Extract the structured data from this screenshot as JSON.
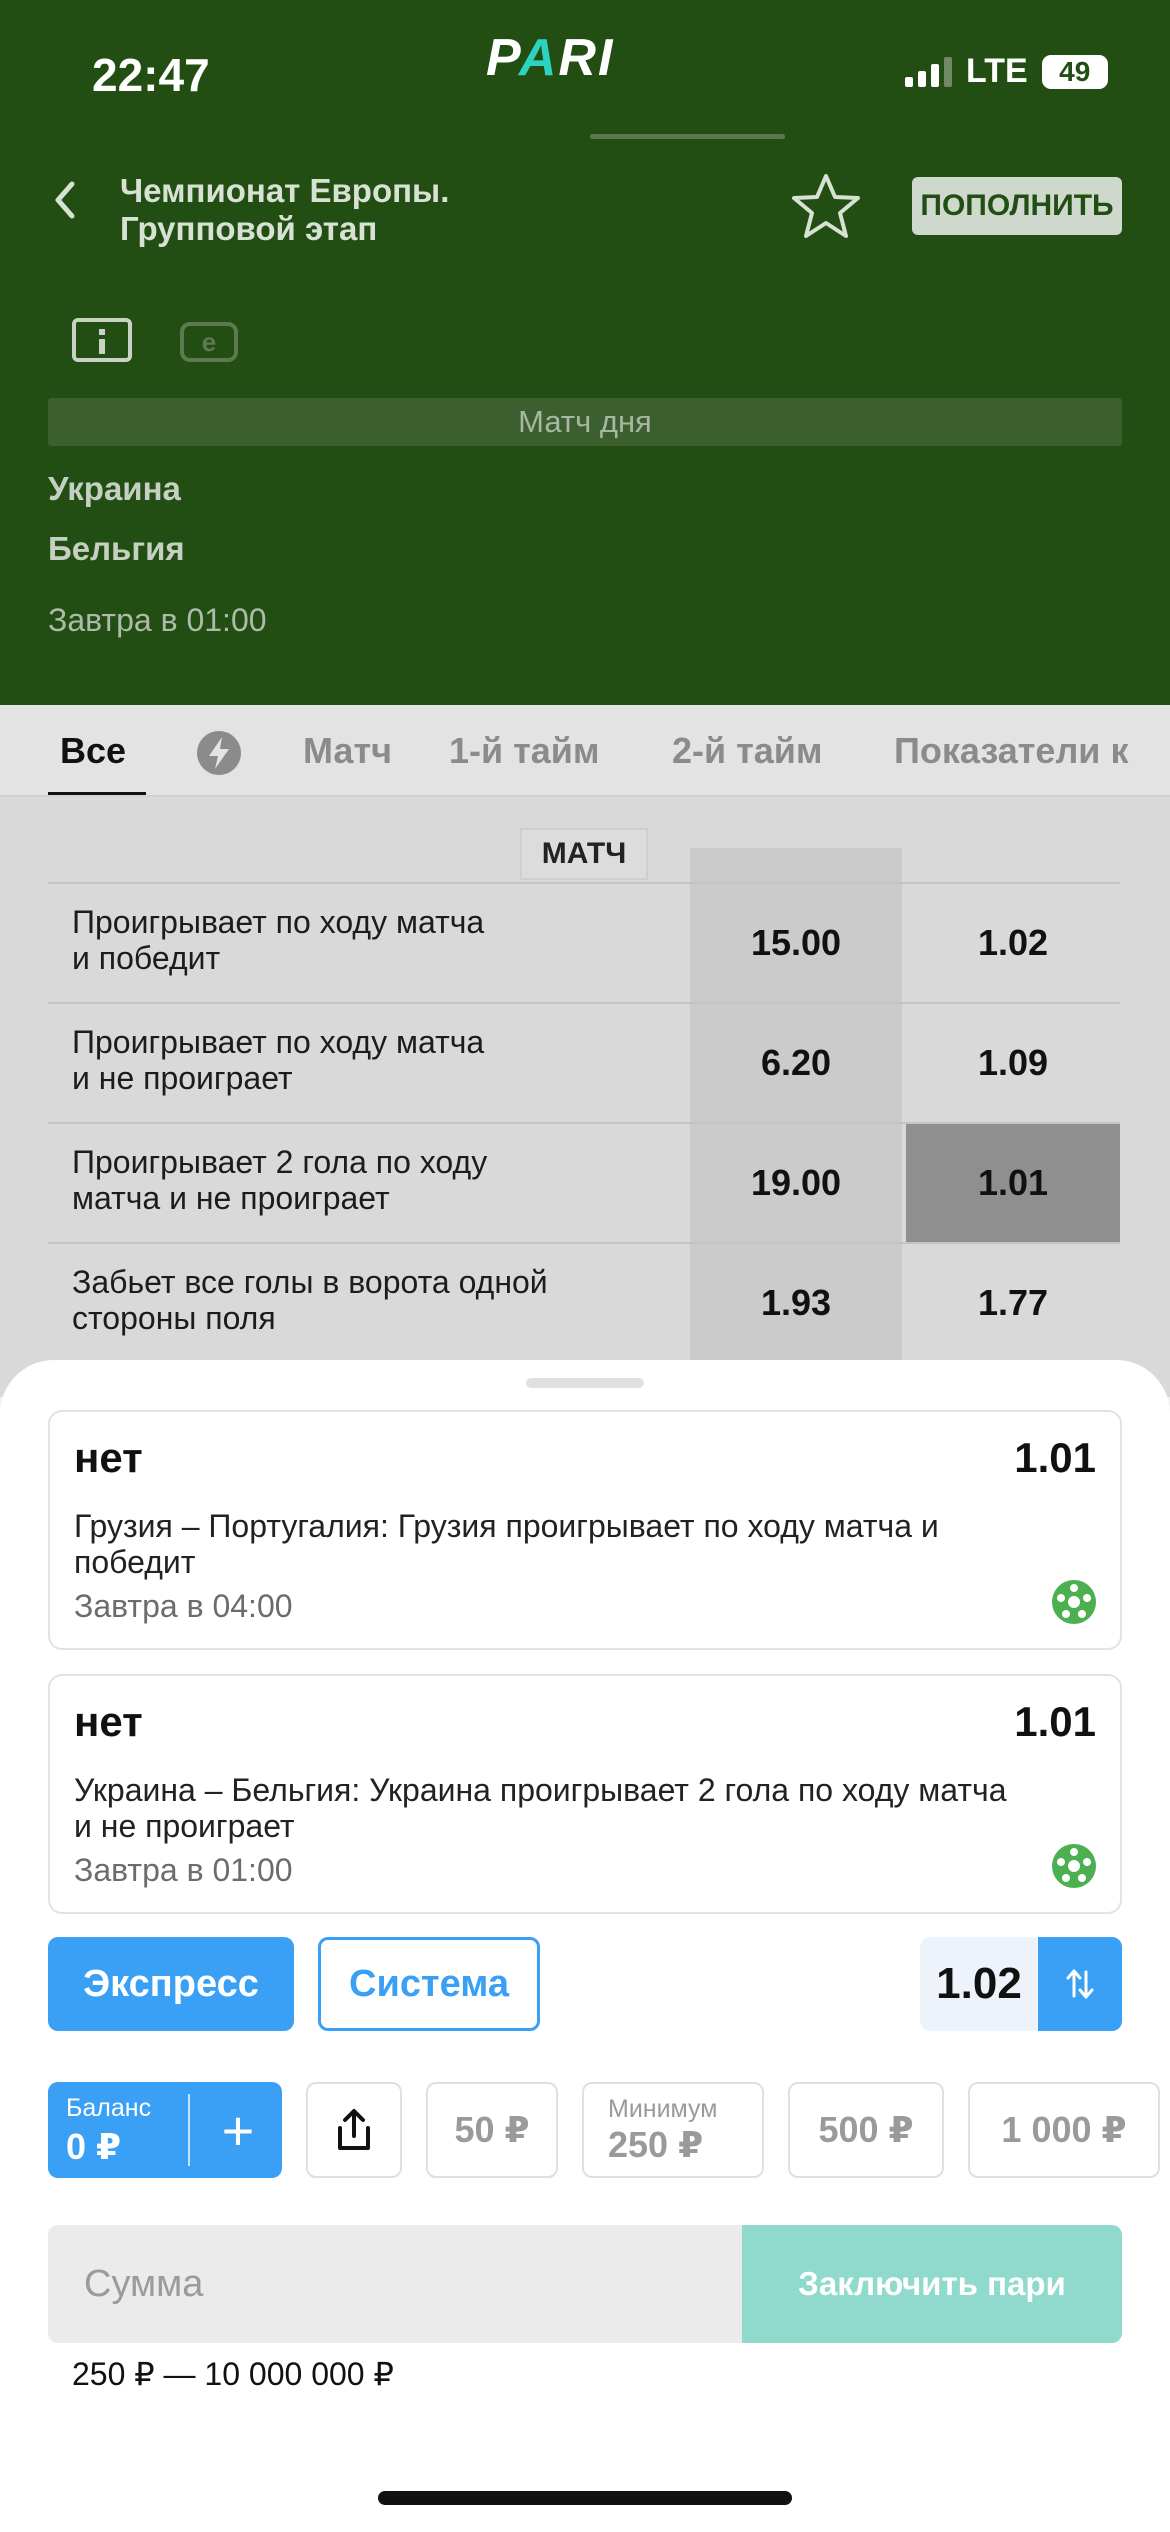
{
  "status_bar": {
    "time": "22:47",
    "network": "LTE",
    "battery": "49"
  },
  "logo": {
    "part1": "P",
    "part2": "A",
    "part3": "RI"
  },
  "header": {
    "tournament_line1": "Чемпионат Европы.",
    "tournament_line2": "Групповой этап",
    "deposit_label": "ПОПОЛНИТЬ",
    "stats_icon_letter": "e",
    "match_of_day": "Матч дня",
    "team1": "Украина",
    "team2": "Бельгия",
    "start_time": "Завтра в 01:00"
  },
  "tabs": [
    "Все",
    "Матч",
    "1-й тайм",
    "2-й тайм",
    "Показатели к"
  ],
  "markets": {
    "section_title": "МАТЧ",
    "rows": [
      {
        "name_line1": "Проигрывает по ходу матча",
        "name_line2": "и победит",
        "yes": "15.00",
        "no": "1.02"
      },
      {
        "name_line1": "Проигрывает по ходу матча",
        "name_line2": "и не проиграет",
        "yes": "6.20",
        "no": "1.09"
      },
      {
        "name_line1": "Проигрывает 2 гола по ходу",
        "name_line2": "матча и не проиграет",
        "yes": "19.00",
        "no": "1.01"
      },
      {
        "name_line1": "Забьет все голы в ворота одной",
        "name_line2": "стороны поля",
        "yes": "1.93",
        "no": "1.77"
      }
    ]
  },
  "betslip": {
    "bets": [
      {
        "outcome": "нет",
        "coef": "1.01",
        "description": "Грузия – Португалия: Грузия проигрывает по ходу матча и победит",
        "time": "Завтра в 04:00"
      },
      {
        "outcome": "нет",
        "coef": "1.01",
        "description": "Украина – Бельгия: Украина проигрывает 2 гола по ходу матча и не проиграет",
        "time": "Завтра в 01:00"
      }
    ],
    "express_label": "Экспресс",
    "system_label": "Система",
    "total_coef": "1.02",
    "balance_label": "Баланс",
    "balance_value": "0 ₽",
    "quick_amounts": [
      "50 ₽",
      "500 ₽",
      "1 000 ₽"
    ],
    "minimum_label": "Минимум",
    "minimum_value": "250 ₽",
    "amount_placeholder": "Сумма",
    "place_bet_label": "Заключить пари",
    "range_text": "250 ₽ — 10 000 000 ₽"
  },
  "colors": {
    "header_bg": "#224e13",
    "accent_blue": "#3aa0f5",
    "place_bet": "#8fd9cd",
    "logo_accent": "#2bd4c0"
  }
}
